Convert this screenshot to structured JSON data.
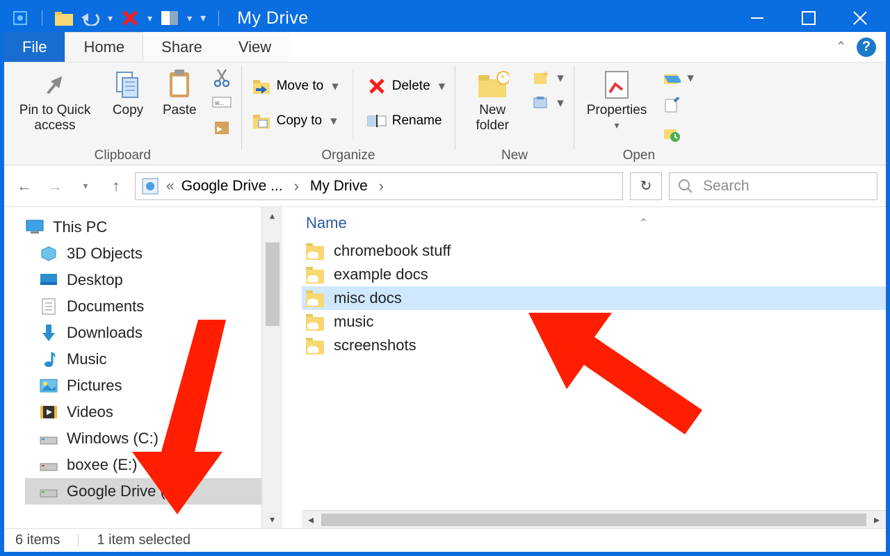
{
  "window": {
    "title": "My Drive"
  },
  "tabs": {
    "file": "File",
    "home": "Home",
    "share": "Share",
    "view": "View"
  },
  "ribbon": {
    "clipboard": {
      "label": "Clipboard",
      "pin": "Pin to Quick access",
      "copy": "Copy",
      "paste": "Paste"
    },
    "organize": {
      "label": "Organize",
      "move_to": "Move to",
      "copy_to": "Copy to",
      "delete": "Delete",
      "rename": "Rename"
    },
    "new": {
      "label": "New",
      "new_folder": "New folder"
    },
    "open": {
      "label": "Open",
      "properties": "Properties"
    }
  },
  "address": {
    "sep_prefix": "«",
    "crumb1": "Google Drive ...",
    "crumb2": "My Drive"
  },
  "search": {
    "placeholder": "Search"
  },
  "tree": {
    "root": "This PC",
    "items": [
      "3D Objects",
      "Desktop",
      "Documents",
      "Downloads",
      "Music",
      "Pictures",
      "Videos",
      "Windows (C:)",
      "boxee (E:)",
      "Google Drive (F:)"
    ]
  },
  "list": {
    "header": "Name",
    "items": [
      "chromebook stuff",
      "example docs",
      "misc docs",
      "music",
      "screenshots"
    ],
    "selected_index": 2
  },
  "status": {
    "count": "6 items",
    "selected": "1 item selected"
  }
}
